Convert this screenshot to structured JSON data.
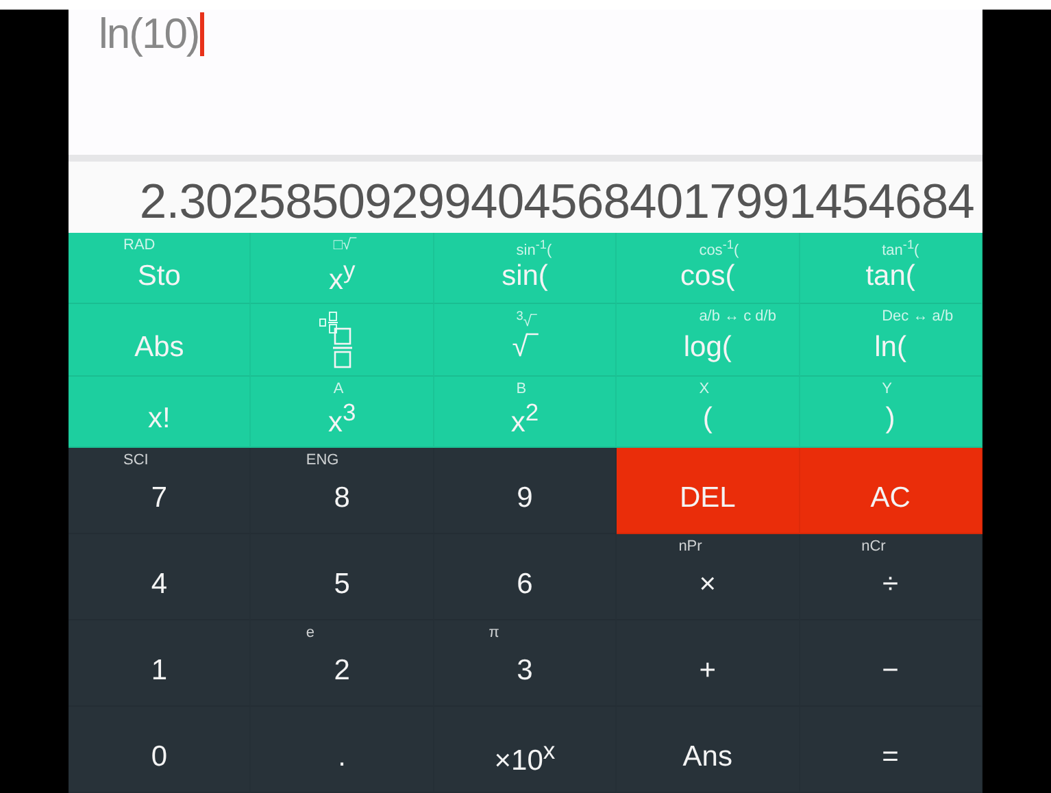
{
  "expression": {
    "value": "ln(10)",
    "cursor": true
  },
  "result": "2.302585092994045684017991454684",
  "function_keys": [
    [
      {
        "label": "Sto",
        "hint": "RAD"
      },
      {
        "label": "x$^{y}$",
        "hint": "□√‾"
      },
      {
        "label": "sin(",
        "hint": "sin$^{-1}$("
      },
      {
        "label": "cos(",
        "hint": "cos$^{-1}$("
      },
      {
        "label": "tan(",
        "hint": "tan$^{-1}$("
      }
    ],
    [
      {
        "label": "Abs"
      },
      {
        "kind": "fraction"
      },
      {
        "label": "√‾",
        "hint": "$^{3}$√‾"
      },
      {
        "label": "log(",
        "hint": "a/b ↔ c d/b"
      },
      {
        "label": "ln(",
        "hint": "Dec ↔ a/b"
      }
    ],
    [
      {
        "label": "x!"
      },
      {
        "label": "x$^{3}$",
        "hint": "A"
      },
      {
        "label": "x$^{2}$",
        "hint": "B"
      },
      {
        "label": "(",
        "hint": "X"
      },
      {
        "label": ")",
        "hint": "Y"
      }
    ]
  ],
  "keys": [
    [
      {
        "label": "7",
        "hint": "SCI",
        "kind": "digit"
      },
      {
        "label": "8",
        "hint": "ENG",
        "kind": "digit"
      },
      {
        "label": "9",
        "kind": "digit"
      },
      {
        "label": "DEL",
        "kind": "danger"
      },
      {
        "label": "AC",
        "kind": "danger"
      }
    ],
    [
      {
        "label": "4",
        "kind": "digit"
      },
      {
        "label": "5",
        "kind": "digit"
      },
      {
        "label": "6",
        "kind": "digit"
      },
      {
        "label": "×",
        "hint": "nPr",
        "kind": "digit"
      },
      {
        "label": "÷",
        "hint": "nCr",
        "kind": "digit"
      }
    ],
    [
      {
        "label": "1",
        "kind": "digit"
      },
      {
        "label": "2",
        "hint": "e",
        "kind": "digit"
      },
      {
        "label": "3",
        "hint": "π",
        "kind": "digit"
      },
      {
        "label": "+",
        "kind": "digit"
      },
      {
        "label": "−",
        "kind": "digit"
      }
    ],
    [
      {
        "label": "0",
        "kind": "digit"
      },
      {
        "label": ".",
        "kind": "digit"
      },
      {
        "label": "×10$^{x}$",
        "kind": "digit"
      },
      {
        "label": "Ans",
        "kind": "digit"
      },
      {
        "label": "=",
        "kind": "digit"
      }
    ]
  ]
}
